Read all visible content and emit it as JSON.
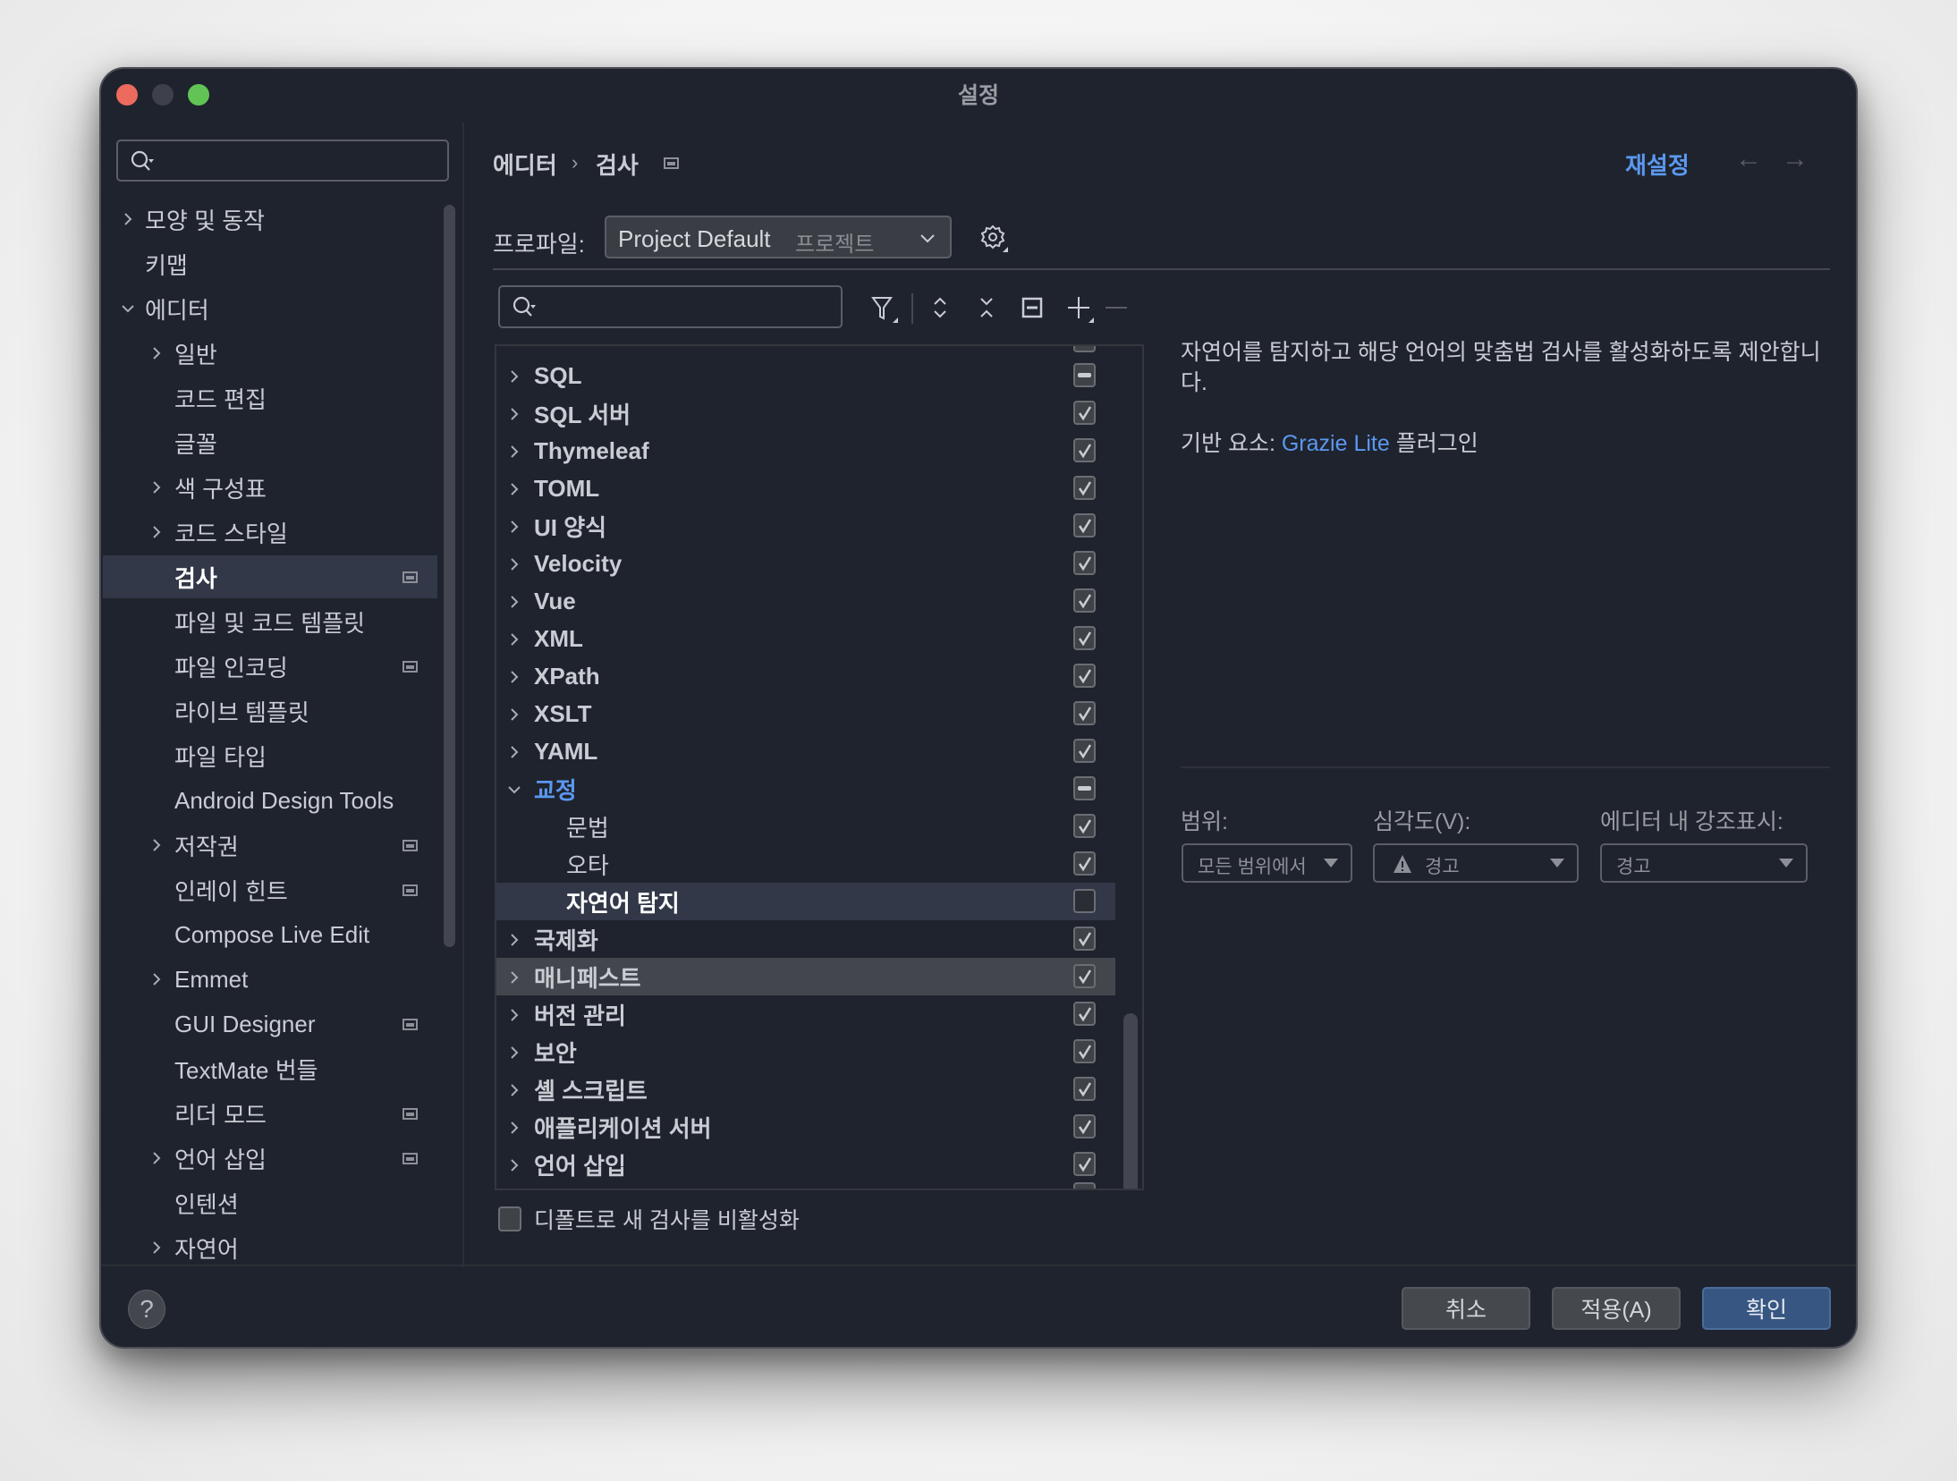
{
  "window": {
    "title": "설정",
    "traffic_lights": {
      "close": "#ed6a5e",
      "minimize": "#3e414b",
      "zoom": "#61c454"
    }
  },
  "sidebar": {
    "search": {
      "value": "",
      "placeholder": "",
      "icon": "search-icon"
    },
    "items": [
      {
        "label": "모양 및 동작",
        "level": 0,
        "chevron": "right",
        "project_icon": false
      },
      {
        "label": "키맵",
        "level": 0,
        "chevron": "none",
        "project_icon": false
      },
      {
        "label": "에디터",
        "level": 0,
        "chevron": "down",
        "project_icon": false
      },
      {
        "label": "일반",
        "level": 1,
        "chevron": "right",
        "project_icon": false
      },
      {
        "label": "코드 편집",
        "level": 1,
        "chevron": "none",
        "project_icon": false
      },
      {
        "label": "글꼴",
        "level": 1,
        "chevron": "none",
        "project_icon": false
      },
      {
        "label": "색 구성표",
        "level": 1,
        "chevron": "right",
        "project_icon": false
      },
      {
        "label": "코드 스타일",
        "level": 1,
        "chevron": "right",
        "project_icon": false
      },
      {
        "label": "검사",
        "level": 1,
        "chevron": "none",
        "project_icon": true,
        "selected": true
      },
      {
        "label": "파일 및 코드 템플릿",
        "level": 1,
        "chevron": "none",
        "project_icon": false
      },
      {
        "label": "파일 인코딩",
        "level": 1,
        "chevron": "none",
        "project_icon": true
      },
      {
        "label": "라이브 템플릿",
        "level": 1,
        "chevron": "none",
        "project_icon": false
      },
      {
        "label": "파일 타입",
        "level": 1,
        "chevron": "none",
        "project_icon": false
      },
      {
        "label": "Android Design Tools",
        "level": 1,
        "chevron": "none",
        "project_icon": false
      },
      {
        "label": "저작권",
        "level": 1,
        "chevron": "right",
        "project_icon": true
      },
      {
        "label": "인레이 힌트",
        "level": 1,
        "chevron": "none",
        "project_icon": true
      },
      {
        "label": "Compose Live Edit",
        "level": 1,
        "chevron": "none",
        "project_icon": false
      },
      {
        "label": "Emmet",
        "level": 1,
        "chevron": "right",
        "project_icon": false
      },
      {
        "label": "GUI Designer",
        "level": 1,
        "chevron": "none",
        "project_icon": true
      },
      {
        "label": "TextMate 번들",
        "level": 1,
        "chevron": "none",
        "project_icon": false
      },
      {
        "label": "리더 모드",
        "level": 1,
        "chevron": "none",
        "project_icon": true
      },
      {
        "label": "언어 삽입",
        "level": 1,
        "chevron": "right",
        "project_icon": true
      },
      {
        "label": "인텐션",
        "level": 1,
        "chevron": "none",
        "project_icon": false
      },
      {
        "label": "자연어",
        "level": 1,
        "chevron": "right",
        "project_icon": false
      }
    ]
  },
  "header": {
    "breadcrumb": [
      "에디터",
      "검사"
    ],
    "breadcrumb_separator": "›",
    "reset_label": "재설정",
    "back_icon": "←",
    "forward_icon": "→"
  },
  "profile": {
    "label": "프로파일:",
    "value": "Project Default",
    "scope_hint": "프로젝트",
    "chevron": "⌄"
  },
  "toolbar": {
    "search": {
      "value": "",
      "placeholder": ""
    },
    "buttons": [
      "filter",
      "expand-all",
      "collapse-all",
      "reset-to-default",
      "add",
      "remove"
    ],
    "glyphs": {
      "expand": "⌃⌄",
      "collapse": "✕",
      "add": "+",
      "remove": "—"
    }
  },
  "tree": {
    "rows": [
      {
        "label": "SQL",
        "chevron": "right",
        "state": "mixed",
        "indent": 0,
        "style": "bold"
      },
      {
        "label": "SQL 서버",
        "chevron": "right",
        "state": "checked",
        "indent": 0,
        "style": "bold"
      },
      {
        "label": "Thymeleaf",
        "chevron": "right",
        "state": "checked",
        "indent": 0,
        "style": "bold"
      },
      {
        "label": "TOML",
        "chevron": "right",
        "state": "checked",
        "indent": 0,
        "style": "bold"
      },
      {
        "label": "UI 양식",
        "chevron": "right",
        "state": "checked",
        "indent": 0,
        "style": "bold"
      },
      {
        "label": "Velocity",
        "chevron": "right",
        "state": "checked",
        "indent": 0,
        "style": "bold"
      },
      {
        "label": "Vue",
        "chevron": "right",
        "state": "checked",
        "indent": 0,
        "style": "bold"
      },
      {
        "label": "XML",
        "chevron": "right",
        "state": "checked",
        "indent": 0,
        "style": "bold"
      },
      {
        "label": "XPath",
        "chevron": "right",
        "state": "checked",
        "indent": 0,
        "style": "bold"
      },
      {
        "label": "XSLT",
        "chevron": "right",
        "state": "checked",
        "indent": 0,
        "style": "bold"
      },
      {
        "label": "YAML",
        "chevron": "right",
        "state": "checked",
        "indent": 0,
        "style": "bold"
      },
      {
        "label": "교정",
        "chevron": "down",
        "state": "mixed",
        "indent": 0,
        "style": "accent"
      },
      {
        "label": "문법",
        "chevron": "none",
        "state": "checked",
        "indent": 1,
        "style": "normal"
      },
      {
        "label": "오타",
        "chevron": "none",
        "state": "checked",
        "indent": 1,
        "style": "normal"
      },
      {
        "label": "자연어 탐지",
        "chevron": "none",
        "state": "unchecked",
        "indent": 1,
        "style": "selected"
      },
      {
        "label": "국제화",
        "chevron": "right",
        "state": "checked",
        "indent": 0,
        "style": "bold"
      },
      {
        "label": "매니페스트",
        "chevron": "right",
        "state": "checked",
        "indent": 0,
        "style": "hover"
      },
      {
        "label": "버전 관리",
        "chevron": "right",
        "state": "checked",
        "indent": 0,
        "style": "bold"
      },
      {
        "label": "보안",
        "chevron": "right",
        "state": "checked",
        "indent": 0,
        "style": "bold"
      },
      {
        "label": "셸 스크립트",
        "chevron": "right",
        "state": "checked",
        "indent": 0,
        "style": "bold"
      },
      {
        "label": "애플리케이션 서버",
        "chevron": "right",
        "state": "checked",
        "indent": 0,
        "style": "bold"
      },
      {
        "label": "언어 삽입",
        "chevron": "right",
        "state": "checked",
        "indent": 0,
        "style": "bold"
      }
    ]
  },
  "disable_new_checkbox": {
    "label": "디폴트로 새 검사를 비활성화",
    "checked": false
  },
  "description": {
    "text": "자연어를 탐지하고 해당 언어의 맞춤법 검사를 활성화하도록 제안합니다.",
    "provider_prefix": "기반 요소:",
    "provider_link": "Grazie Lite",
    "provider_suffix": "플러그인"
  },
  "options": {
    "scope": {
      "label": "범위:",
      "value": "모든 범위에서"
    },
    "severity": {
      "label": "심각도(V):",
      "value": "경고",
      "icon": "warning-icon"
    },
    "highlight": {
      "label": "에디터 내 강조표시:",
      "value": "경고"
    }
  },
  "footer": {
    "help": "?",
    "cancel": "취소",
    "apply": "적용(A)",
    "ok": "확인"
  },
  "colors": {
    "accent": "#5b98f0",
    "primary_button": "#375782",
    "selection": "#323848",
    "background": "#1f232d"
  }
}
